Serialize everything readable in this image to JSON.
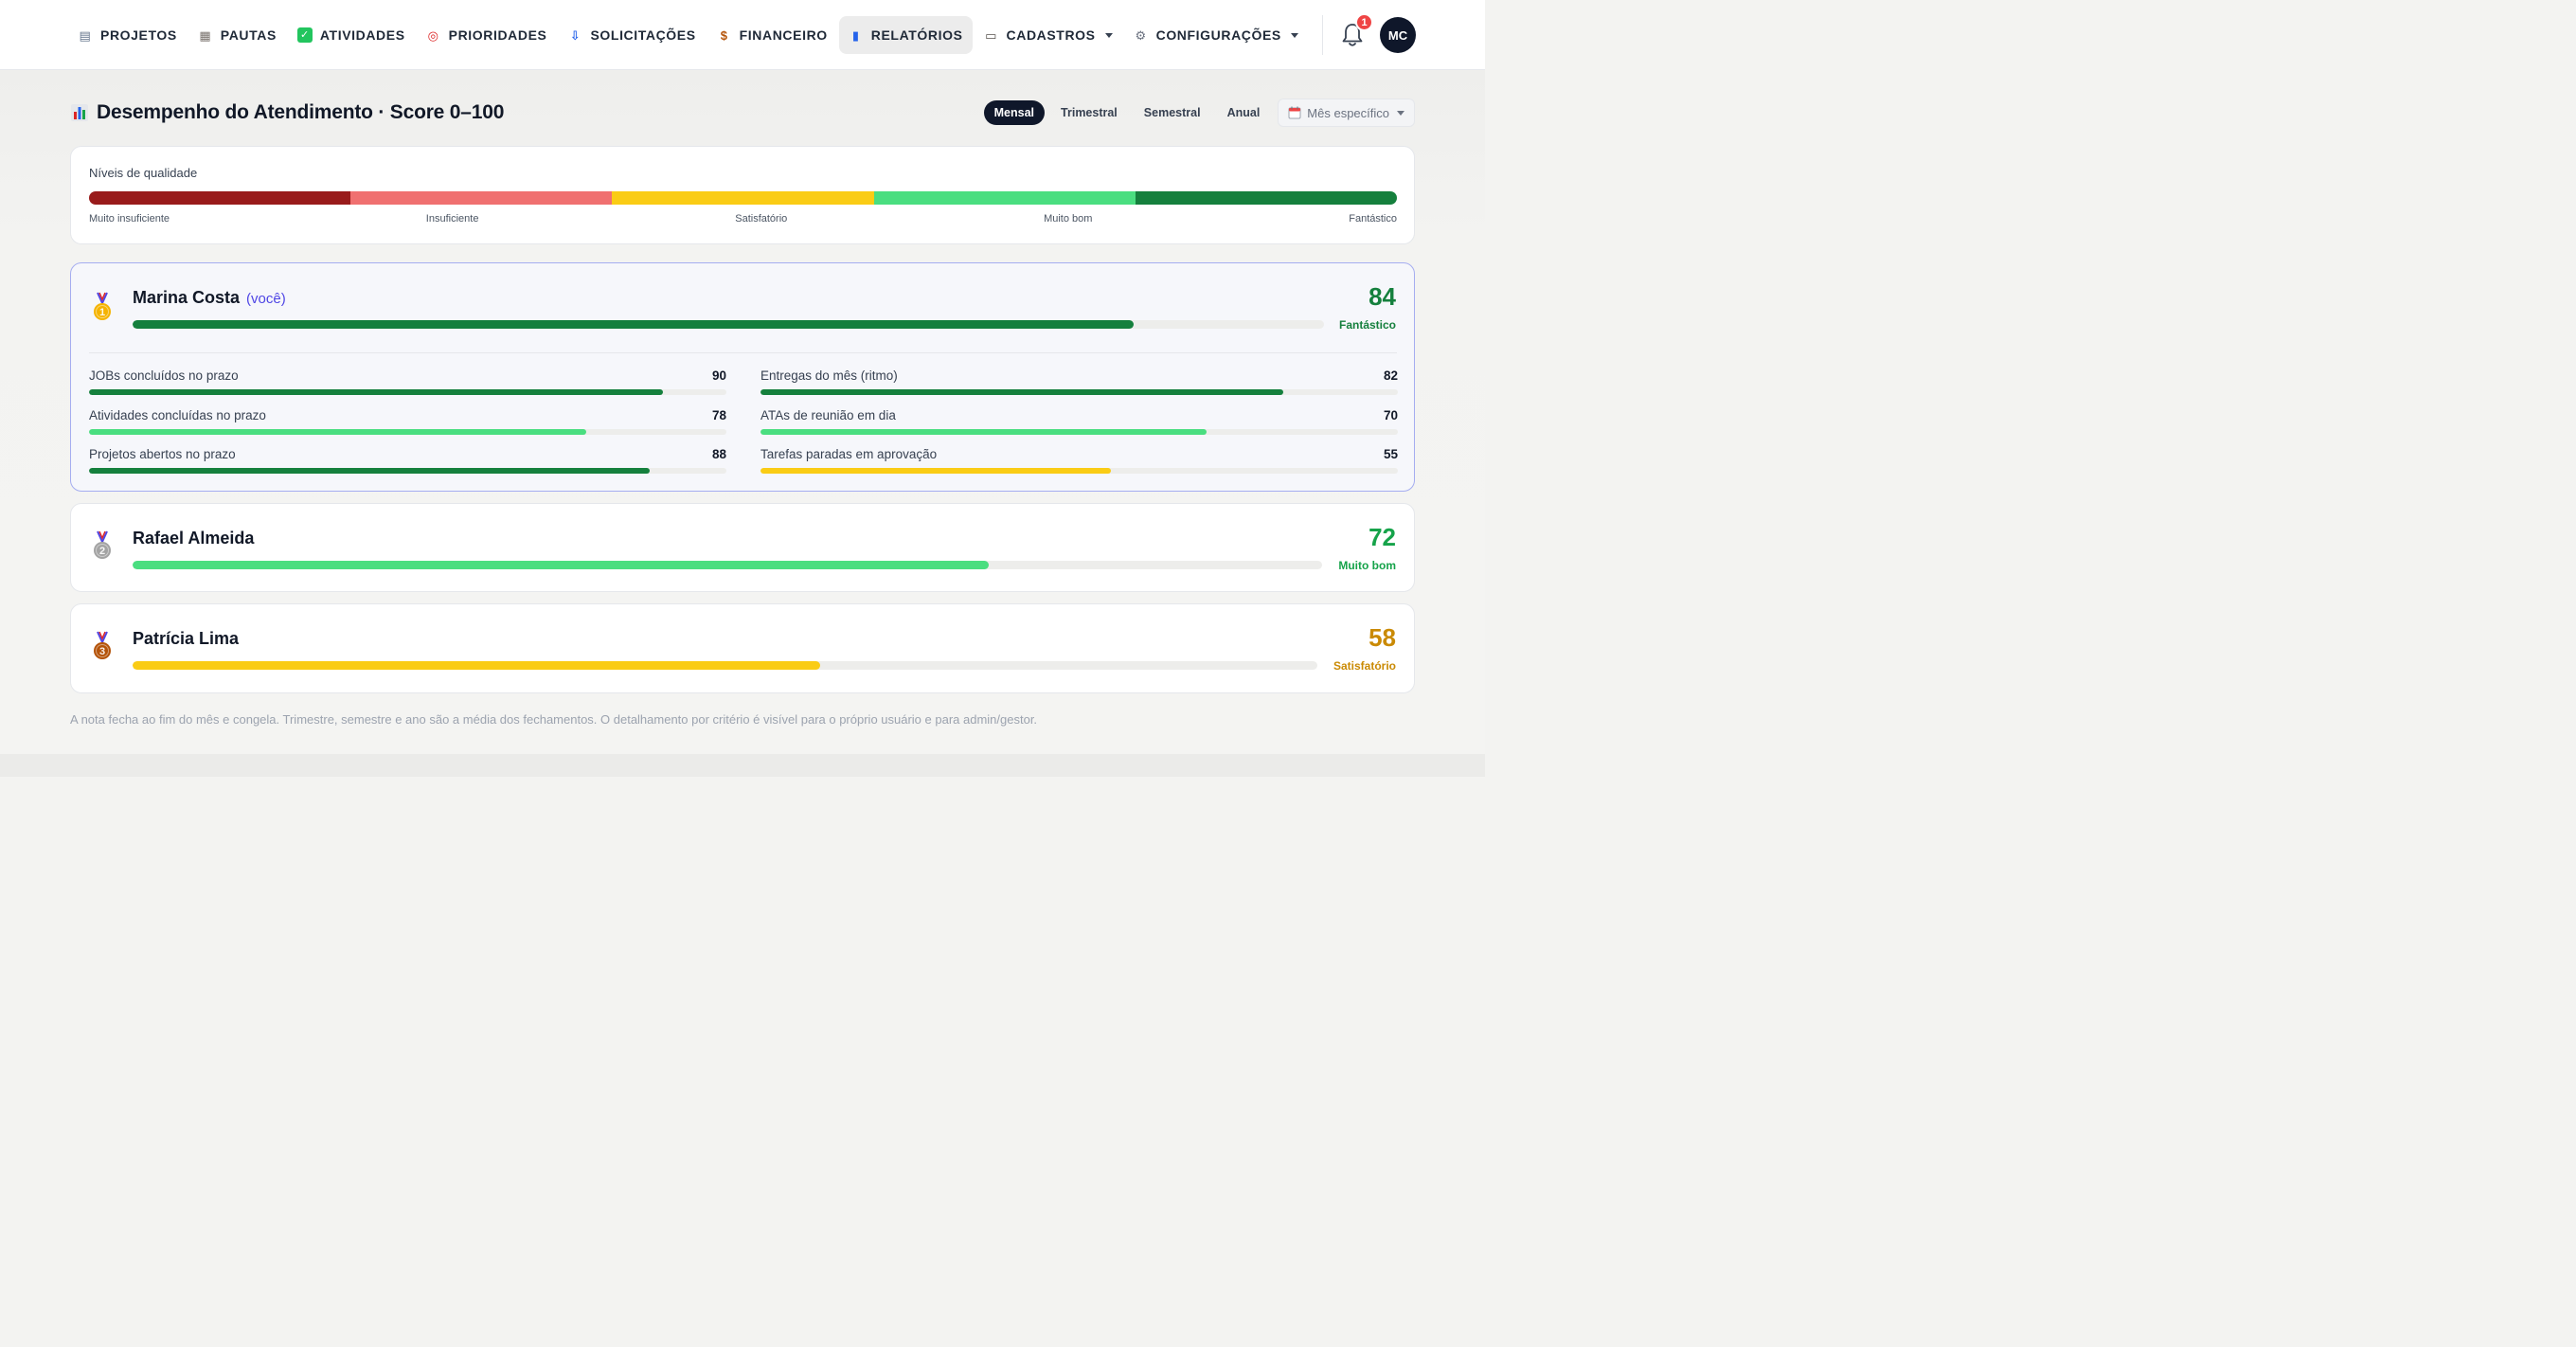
{
  "nav": {
    "items": [
      {
        "id": "projetos",
        "label": "PROJETOS",
        "icon": "folder-icon",
        "glyph": "▤",
        "active": false,
        "dropdown": false
      },
      {
        "id": "pautas",
        "label": "PAUTAS",
        "icon": "notepad-icon",
        "glyph": "▦",
        "active": false,
        "dropdown": false
      },
      {
        "id": "atividades",
        "label": "ATIVIDADES",
        "icon": "check-icon",
        "glyph": "✓",
        "active": false,
        "dropdown": false
      },
      {
        "id": "prioridades",
        "label": "PRIORIDADES",
        "icon": "target-icon",
        "glyph": "◎",
        "active": false,
        "dropdown": false
      },
      {
        "id": "solicitacoes",
        "label": "SOLICITAÇÕES",
        "icon": "inbox-icon",
        "glyph": "⇩",
        "active": false,
        "dropdown": false
      },
      {
        "id": "financeiro",
        "label": "FINANCEIRO",
        "icon": "money-bag-icon",
        "glyph": "$",
        "active": false,
        "dropdown": false
      },
      {
        "id": "relatorios",
        "label": "RELATÓRIOS",
        "icon": "bar-chart-icon",
        "glyph": "▮",
        "active": true,
        "dropdown": false
      },
      {
        "id": "cadastros",
        "label": "CADASTROS",
        "icon": "card-file-icon",
        "glyph": "▭",
        "active": false,
        "dropdown": true
      },
      {
        "id": "configuracoes",
        "label": "CONFIGURAÇÕES",
        "icon": "gear-icon",
        "glyph": "⚙",
        "active": false,
        "dropdown": true
      }
    ],
    "notifications_count": "1",
    "avatar_initials": "MC"
  },
  "page": {
    "title": "Desempenho do Atendimento · Score 0–100",
    "periods": [
      {
        "label": "Mensal",
        "active": true
      },
      {
        "label": "Trimestral",
        "active": false
      },
      {
        "label": "Semestral",
        "active": false
      },
      {
        "label": "Anual",
        "active": false
      }
    ],
    "month_select": "Mês específico"
  },
  "legend": {
    "title": "Níveis de qualidade",
    "levels": [
      {
        "label": "Muito insuficiente",
        "color": "#991b1b"
      },
      {
        "label": "Insuficiente",
        "color": "#f07070"
      },
      {
        "label": "Satisfatório",
        "color": "#facc15"
      },
      {
        "label": "Muito bom",
        "color": "#4ade80"
      },
      {
        "label": "Fantástico",
        "color": "#15803d"
      }
    ]
  },
  "people": [
    {
      "rank": "1",
      "name": "Marina Costa",
      "you_label": "(você)",
      "score": 84,
      "score_display": "84",
      "level": "Fantástico",
      "color": "#15803d",
      "score_color": "#15803d",
      "medal_color": "#f5b301",
      "criteria": [
        {
          "name": "JOBs concluídos no prazo",
          "value": 90,
          "value_display": "90",
          "color": "#15803d"
        },
        {
          "name": "Entregas do mês (ritmo)",
          "value": 82,
          "value_display": "82",
          "color": "#15803d"
        },
        {
          "name": "Atividades concluídas no prazo",
          "value": 78,
          "value_display": "78",
          "color": "#4ade80"
        },
        {
          "name": "ATAs de reunião em dia",
          "value": 70,
          "value_display": "70",
          "color": "#4ade80"
        },
        {
          "name": "Projetos abertos no prazo",
          "value": 88,
          "value_display": "88",
          "color": "#15803d"
        },
        {
          "name": "Tarefas paradas em aprovação",
          "value": 55,
          "value_display": "55",
          "color": "#facc15"
        }
      ]
    },
    {
      "rank": "2",
      "name": "Rafael Almeida",
      "score": 72,
      "score_display": "72",
      "level": "Muito bom",
      "color": "#4ade80",
      "score_color": "#16a34a",
      "medal_color": "#a3a3a3"
    },
    {
      "rank": "3",
      "name": "Patrícia Lima",
      "score": 58,
      "score_display": "58",
      "level": "Satisfatório",
      "color": "#facc15",
      "score_color": "#ca8a04",
      "medal_color": "#b45309"
    }
  ],
  "footnote": "A nota fecha ao fim do mês e congela. Trimestre, semestre e ano são a média dos fechamentos. O detalhamento por critério é visível para o próprio usuário e para admin/gestor."
}
